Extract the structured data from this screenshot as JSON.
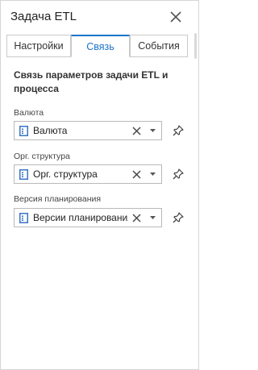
{
  "window": {
    "title": "Задача ETL"
  },
  "tabs": [
    {
      "label": "Настройки"
    },
    {
      "label": "Связь"
    },
    {
      "label": "События"
    }
  ],
  "active_tab": "Связь",
  "section": {
    "title": "Связь параметров задачи ETL и процесса"
  },
  "fields": [
    {
      "label": "Валюта",
      "value": "Валюта"
    },
    {
      "label": "Орг. структура",
      "value": "Орг. структура"
    },
    {
      "label": "Версия планирования",
      "value": "Версии планирования"
    }
  ],
  "icons": {
    "close": "close-icon",
    "document": "document-icon",
    "clear": "clear-icon",
    "dropdown": "chevron-down-icon",
    "pin": "pin-icon"
  },
  "colors": {
    "accent": "#1a73c9",
    "doc_icon": "#3a74c4",
    "border": "#b9b9b9"
  }
}
